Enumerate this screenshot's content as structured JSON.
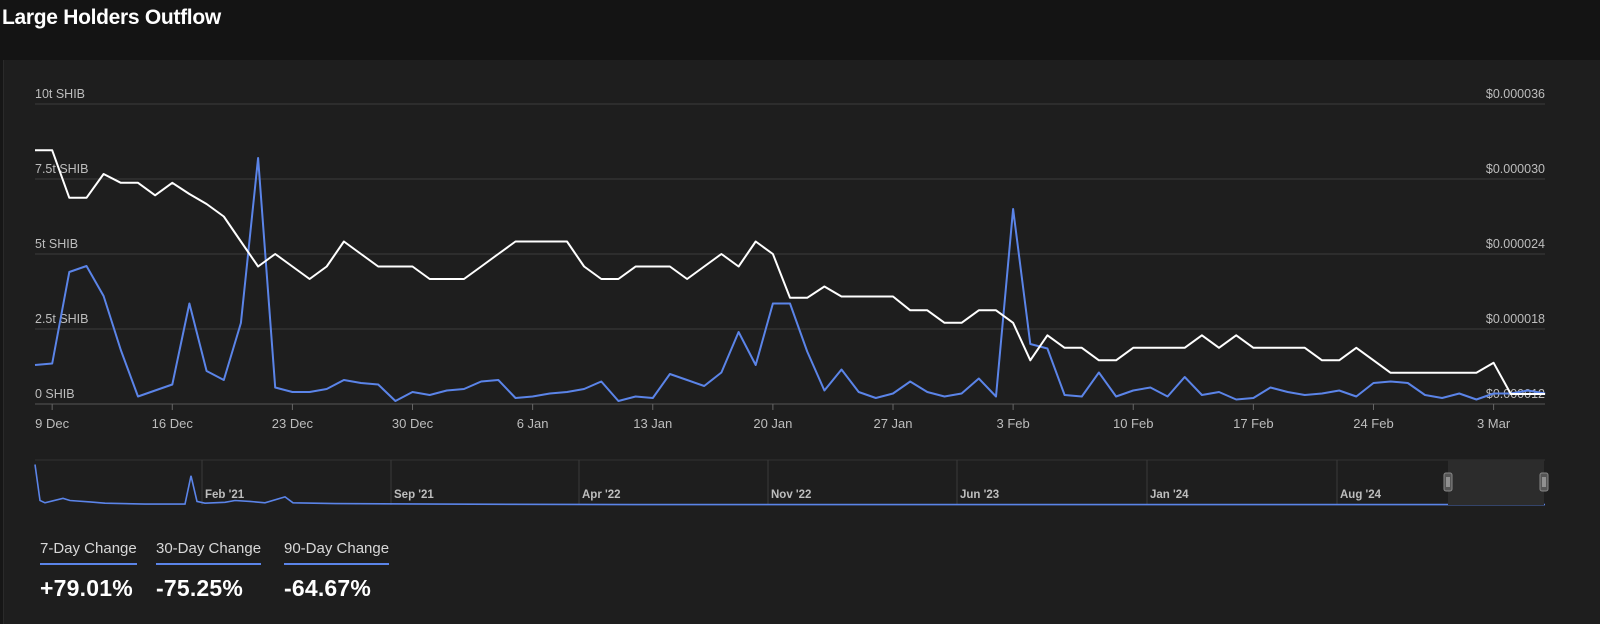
{
  "title": "Large Holders Outflow",
  "colors": {
    "outflow": "#5b84e8",
    "price": "#ffffff",
    "grid": "#3c3c3c",
    "axis_text": "#bdbdbd",
    "background": "#1e1e1e"
  },
  "chart_data": {
    "type": "line",
    "left_axis": {
      "ticks": [
        {
          "value": 0,
          "label": "0 SHIB"
        },
        {
          "value": 2.5,
          "label": "2.5t SHIB"
        },
        {
          "value": 5,
          "label": "5t SHIB"
        },
        {
          "value": 7.5,
          "label": "7.5t SHIB"
        },
        {
          "value": 10,
          "label": "10t SHIB"
        }
      ],
      "range": [
        0,
        10
      ]
    },
    "right_axis": {
      "ticks": [
        {
          "value": 1.2e-05,
          "label": "$0.000012"
        },
        {
          "value": 1.8e-05,
          "label": "$0.000018"
        },
        {
          "value": 2.4e-05,
          "label": "$0.000024"
        },
        {
          "value": 3e-05,
          "label": "$0.000030"
        },
        {
          "value": 3.6e-05,
          "label": "$0.000036"
        }
      ],
      "range": [
        1.2e-05,
        3.6e-05
      ]
    },
    "x_axis": {
      "range_days": [
        0,
        88
      ],
      "ticks": [
        {
          "day": 1,
          "label": "9 Dec"
        },
        {
          "day": 8,
          "label": "16 Dec"
        },
        {
          "day": 15,
          "label": "23 Dec"
        },
        {
          "day": 22,
          "label": "30 Dec"
        },
        {
          "day": 29,
          "label": "6 Jan"
        },
        {
          "day": 36,
          "label": "13 Jan"
        },
        {
          "day": 43,
          "label": "20 Jan"
        },
        {
          "day": 50,
          "label": "27 Jan"
        },
        {
          "day": 57,
          "label": "3 Feb"
        },
        {
          "day": 64,
          "label": "10 Feb"
        },
        {
          "day": 71,
          "label": "17 Feb"
        },
        {
          "day": 78,
          "label": "24 Feb"
        },
        {
          "day": 85,
          "label": "3 Mar"
        }
      ]
    },
    "series": [
      {
        "key": "outflow",
        "axis": "left",
        "points": [
          [
            0,
            1.3
          ],
          [
            1,
            1.35
          ],
          [
            2,
            4.4
          ],
          [
            3,
            4.6
          ],
          [
            4,
            3.6
          ],
          [
            5,
            1.8
          ],
          [
            6,
            0.25
          ],
          [
            7,
            0.45
          ],
          [
            8,
            0.65
          ],
          [
            9,
            3.35
          ],
          [
            10,
            1.1
          ],
          [
            11,
            0.8
          ],
          [
            12,
            2.7
          ],
          [
            13,
            8.2
          ],
          [
            14,
            0.55
          ],
          [
            15,
            0.4
          ],
          [
            16,
            0.4
          ],
          [
            17,
            0.5
          ],
          [
            18,
            0.8
          ],
          [
            19,
            0.7
          ],
          [
            20,
            0.65
          ],
          [
            21,
            0.1
          ],
          [
            22,
            0.4
          ],
          [
            23,
            0.3
          ],
          [
            24,
            0.45
          ],
          [
            25,
            0.5
          ],
          [
            26,
            0.75
          ],
          [
            27,
            0.8
          ],
          [
            28,
            0.2
          ],
          [
            29,
            0.25
          ],
          [
            30,
            0.35
          ],
          [
            31,
            0.4
          ],
          [
            32,
            0.5
          ],
          [
            33,
            0.75
          ],
          [
            34,
            0.1
          ],
          [
            35,
            0.25
          ],
          [
            36,
            0.2
          ],
          [
            37,
            1.0
          ],
          [
            38,
            0.8
          ],
          [
            39,
            0.6
          ],
          [
            40,
            1.05
          ],
          [
            41,
            2.4
          ],
          [
            42,
            1.3
          ],
          [
            43,
            3.35
          ],
          [
            44,
            3.35
          ],
          [
            45,
            1.75
          ],
          [
            46,
            0.45
          ],
          [
            47,
            1.15
          ],
          [
            48,
            0.4
          ],
          [
            49,
            0.2
          ],
          [
            50,
            0.35
          ],
          [
            51,
            0.75
          ],
          [
            52,
            0.4
          ],
          [
            53,
            0.25
          ],
          [
            54,
            0.35
          ],
          [
            55,
            0.85
          ],
          [
            56,
            0.25
          ],
          [
            57,
            6.5
          ],
          [
            58,
            2.0
          ],
          [
            59,
            1.85
          ],
          [
            60,
            0.3
          ],
          [
            61,
            0.25
          ],
          [
            62,
            1.05
          ],
          [
            63,
            0.25
          ],
          [
            64,
            0.45
          ],
          [
            65,
            0.55
          ],
          [
            66,
            0.25
          ],
          [
            67,
            0.9
          ],
          [
            68,
            0.3
          ],
          [
            69,
            0.4
          ],
          [
            70,
            0.15
          ],
          [
            71,
            0.2
          ],
          [
            72,
            0.55
          ],
          [
            73,
            0.4
          ],
          [
            74,
            0.3
          ],
          [
            75,
            0.35
          ],
          [
            76,
            0.45
          ],
          [
            77,
            0.25
          ],
          [
            78,
            0.7
          ],
          [
            79,
            0.75
          ],
          [
            80,
            0.7
          ],
          [
            81,
            0.3
          ],
          [
            82,
            0.2
          ],
          [
            83,
            0.35
          ],
          [
            84,
            0.15
          ],
          [
            85,
            0.35
          ],
          [
            86,
            0.35
          ],
          [
            87,
            0.45
          ],
          [
            88,
            0.35
          ]
        ]
      },
      {
        "key": "price",
        "axis": "right",
        "points": [
          [
            0,
            3.23e-05
          ],
          [
            1,
            3.23e-05
          ],
          [
            2,
            2.85e-05
          ],
          [
            3,
            2.85e-05
          ],
          [
            4,
            3.04e-05
          ],
          [
            5,
            2.97e-05
          ],
          [
            6,
            2.97e-05
          ],
          [
            7,
            2.87e-05
          ],
          [
            8,
            2.97e-05
          ],
          [
            9,
            2.88e-05
          ],
          [
            10,
            2.8e-05
          ],
          [
            11,
            2.7e-05
          ],
          [
            12,
            2.5e-05
          ],
          [
            13,
            2.3e-05
          ],
          [
            14,
            2.4e-05
          ],
          [
            15,
            2.3e-05
          ],
          [
            16,
            2.2e-05
          ],
          [
            17,
            2.3e-05
          ],
          [
            18,
            2.5e-05
          ],
          [
            19,
            2.4e-05
          ],
          [
            20,
            2.3e-05
          ],
          [
            21,
            2.3e-05
          ],
          [
            22,
            2.3e-05
          ],
          [
            23,
            2.2e-05
          ],
          [
            24,
            2.2e-05
          ],
          [
            25,
            2.2e-05
          ],
          [
            26,
            2.3e-05
          ],
          [
            27,
            2.4e-05
          ],
          [
            28,
            2.5e-05
          ],
          [
            29,
            2.5e-05
          ],
          [
            30,
            2.5e-05
          ],
          [
            31,
            2.5e-05
          ],
          [
            32,
            2.3e-05
          ],
          [
            33,
            2.2e-05
          ],
          [
            34,
            2.2e-05
          ],
          [
            35,
            2.3e-05
          ],
          [
            36,
            2.3e-05
          ],
          [
            37,
            2.3e-05
          ],
          [
            38,
            2.2e-05
          ],
          [
            39,
            2.3e-05
          ],
          [
            40,
            2.4e-05
          ],
          [
            41,
            2.3e-05
          ],
          [
            42,
            2.5e-05
          ],
          [
            43,
            2.4e-05
          ],
          [
            44,
            2.05e-05
          ],
          [
            45,
            2.05e-05
          ],
          [
            46,
            2.14e-05
          ],
          [
            47,
            2.06e-05
          ],
          [
            48,
            2.06e-05
          ],
          [
            49,
            2.06e-05
          ],
          [
            50,
            2.06e-05
          ],
          [
            51,
            1.95e-05
          ],
          [
            52,
            1.95e-05
          ],
          [
            53,
            1.85e-05
          ],
          [
            54,
            1.85e-05
          ],
          [
            55,
            1.95e-05
          ],
          [
            56,
            1.95e-05
          ],
          [
            57,
            1.85e-05
          ],
          [
            58,
            1.55e-05
          ],
          [
            59,
            1.75e-05
          ],
          [
            60,
            1.65e-05
          ],
          [
            61,
            1.65e-05
          ],
          [
            62,
            1.55e-05
          ],
          [
            63,
            1.55e-05
          ],
          [
            64,
            1.65e-05
          ],
          [
            65,
            1.65e-05
          ],
          [
            66,
            1.65e-05
          ],
          [
            67,
            1.65e-05
          ],
          [
            68,
            1.75e-05
          ],
          [
            69,
            1.65e-05
          ],
          [
            70,
            1.75e-05
          ],
          [
            71,
            1.65e-05
          ],
          [
            72,
            1.65e-05
          ],
          [
            73,
            1.65e-05
          ],
          [
            74,
            1.65e-05
          ],
          [
            75,
            1.55e-05
          ],
          [
            76,
            1.55e-05
          ],
          [
            77,
            1.65e-05
          ],
          [
            78,
            1.55e-05
          ],
          [
            79,
            1.45e-05
          ],
          [
            80,
            1.45e-05
          ],
          [
            81,
            1.45e-05
          ],
          [
            82,
            1.45e-05
          ],
          [
            83,
            1.45e-05
          ],
          [
            84,
            1.45e-05
          ],
          [
            85,
            1.53e-05
          ],
          [
            86,
            1.28e-05
          ],
          [
            87,
            1.28e-05
          ],
          [
            88,
            1.28e-05
          ]
        ]
      }
    ],
    "navigator": {
      "labels": [
        "Feb '21",
        "Sep '21",
        "Apr '22",
        "Nov '22",
        "Jun '23",
        "Jan '24",
        "Aug '24"
      ]
    }
  },
  "stats": [
    {
      "label": "7-Day Change",
      "value": "+79.01%"
    },
    {
      "label": "30-Day Change",
      "value": "-75.25%"
    },
    {
      "label": "90-Day Change",
      "value": "-64.67%"
    }
  ]
}
